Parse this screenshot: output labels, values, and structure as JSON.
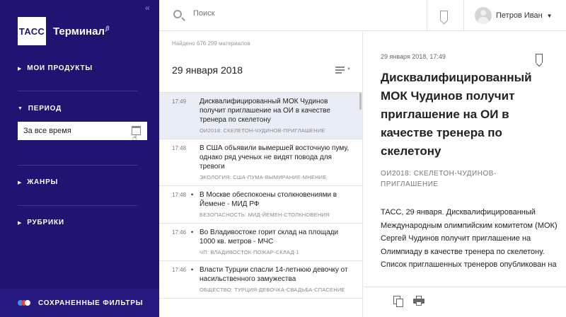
{
  "sidebar": {
    "collapse_glyph": "«",
    "logo_text": "ТАСС",
    "app_title": "Терминал",
    "beta_mark": "β",
    "sections": {
      "products": "МОИ ПРОДУКТЫ",
      "period": "ПЕРИОД",
      "genres": "ЖАНРЫ",
      "rubrics": "РУБРИКИ"
    },
    "period_value": "За все время",
    "saved_filters": "СОХРАНЕННЫЕ ФИЛЬТРЫ",
    "colors": {
      "background": "#1f1472",
      "accent_blue": "#3a8ef6",
      "accent_red": "#e8403a"
    }
  },
  "search": {
    "placeholder": "Поиск"
  },
  "user": {
    "name": "Петров Иван"
  },
  "list": {
    "found_text": "Найдено 676 299 материалов",
    "date_heading": "29 января 2018",
    "items": [
      {
        "time": "17:49",
        "bullet": "",
        "title": "Дисквалифицированный МОК Чудинов получит приглашение на ОИ в качестве тренера по скелетону",
        "tag": "ОИ2018: СКЕЛЕТОН-ЧУДИНОВ-ПРИГЛАШЕНИЕ"
      },
      {
        "time": "17:48",
        "bullet": "",
        "title": "В США объявили вымершей восточную пуму, однако ряд ученых не видят повода для тревоги",
        "tag": "ЭКОЛОГИЯ: США-ПУМА-ВЫМИРАНИЕ-МНЕНИЕ"
      },
      {
        "time": "17:48",
        "bullet": "•",
        "title": "В Москве обеспокоены столкновениями в Йемене - МИД РФ",
        "tag": "БЕЗОПАСНОСТЬ: МИД-ЙЕМЕН-СТОЛКНОВЕНИЯ"
      },
      {
        "time": "17:46",
        "bullet": "•",
        "title": "Во Владивостоке горит склад на площади 1000 кв. метров - МЧС",
        "tag": "ЧП: ВЛАДИВОСТОК-ПОЖАР-СКЛАД-1"
      },
      {
        "time": "17:46",
        "bullet": "•",
        "title": "Власти Турции спасли 14-летнюю девочку от насильственного замужества",
        "tag": "ОБЩЕСТВО: ТУРЦИЯ-ДЕВОЧКА-СВАДЬБА-СПАСЕНИЕ"
      }
    ]
  },
  "article": {
    "date": "29 января 2018, 17:49",
    "title": "Дисквалифицированный МОК Чудинов получит приглашение на ОИ в качестве тренера по скелетону",
    "tag": "ОИ2018: СКЕЛЕТОН-ЧУДИНОВ-ПРИГЛАШЕНИЕ",
    "body": "ТАСС, 29 января. Дисквалифицированный Международным олимпийским комитетом (МОК) Сергей Чудинов получит приглашение на Олимпиаду в качестве тренера по скелетону. Список приглашенных тренеров опубликован на"
  }
}
